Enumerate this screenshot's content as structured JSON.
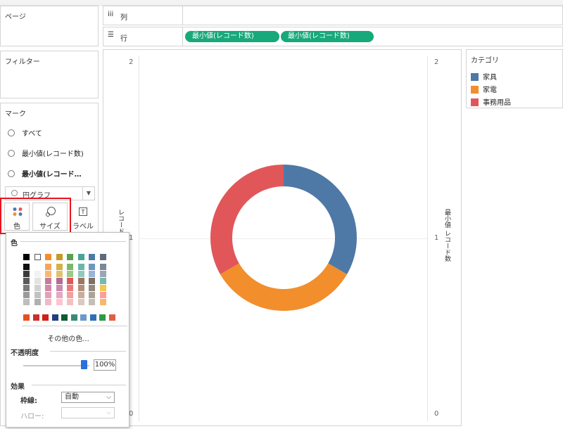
{
  "left_panel": {
    "pages_title": "ページ",
    "filters_title": "フィルター",
    "marks_title": "マーク",
    "marks_items": [
      "すべて",
      "最小値(レコード数)",
      "最小値(レコード…"
    ],
    "mark_type": "円グラフ",
    "buttons": {
      "color": "色",
      "size": "サイズ",
      "label": "ラベル"
    }
  },
  "shelves": {
    "columns_label": "列",
    "rows_label": "行",
    "rows_pills": [
      "最小値(レコード数)",
      "最小値(レコード数)"
    ]
  },
  "legend": {
    "title": "カテゴリ",
    "items": [
      {
        "label": "家具",
        "color": "#4e79a7"
      },
      {
        "label": "家電",
        "color": "#f28e2b"
      },
      {
        "label": "事務用品",
        "color": "#e15759"
      }
    ]
  },
  "chart_data": {
    "type": "pie",
    "donut": true,
    "slices": [
      {
        "label": "家具",
        "value": 1
      },
      {
        "label": "家電",
        "value": 1
      },
      {
        "label": "事務用品",
        "value": 1
      }
    ],
    "left_axis": {
      "ticks": [
        "2",
        "1",
        "0"
      ],
      "label": "レコード数"
    },
    "right_axis": {
      "ticks": [
        "2",
        "1",
        "0"
      ],
      "label": "最小値 レコード数"
    }
  },
  "color_popup": {
    "title": "色",
    "more_colors": "その他の色...",
    "opacity_label": "不透明度",
    "opacity_value": "100%",
    "opacity": 1.0,
    "effects_label": "効果",
    "border_label": "枠線:",
    "border_value": "自動",
    "halo_label": "ハロー:",
    "halo_value": "",
    "palette_top": [
      "#000000",
      "#ffffff",
      "#f28e2b",
      "#c49a28",
      "#59a14f",
      "#49a399",
      "#4e79a7",
      "#5b6b7d"
    ],
    "palette_cols": [
      [
        "#111111",
        "#3a3a3a",
        "#5a5a5a",
        "#7a7a7a",
        "#9a9a9a",
        "#bdbdbd"
      ],
      [
        "#ffffff",
        "#f2f2f2",
        "#e2e2e2",
        "#d2d2d2",
        "#c2c2c2",
        "#b0b0b0"
      ],
      [
        "#f5a55a",
        "#f7b874",
        "#c77b9b",
        "#d18aa9",
        "#e4a0b6",
        "#f0b9c9"
      ],
      [
        "#d4b04a",
        "#dfc270",
        "#b46a96",
        "#c98ab0",
        "#e6a7c0",
        "#ffc2d2"
      ],
      [
        "#7ab86a",
        "#9cc98d",
        "#e15759",
        "#eb7a7b",
        "#f2a0a0",
        "#f7c0c0"
      ],
      [
        "#6db5ab",
        "#93c8bf",
        "#9c755f",
        "#b0907c",
        "#c7ad9b",
        "#dcc9bb"
      ],
      [
        "#6f95c1",
        "#98b4d6",
        "#7c6f63",
        "#94897e",
        "#aca398",
        "#c6beb4"
      ],
      [
        "#7a8898",
        "#9aa6b3",
        "#76b7b2",
        "#f0c84a",
        "#ff9d9a",
        "#f6b86a"
      ]
    ],
    "palette_bottom": [
      "#e8501f",
      "#c9302c",
      "#d0201a",
      "#204080",
      "#0e5a34",
      "#3a8a7a",
      "#6a9ac9",
      "#2f6fb5",
      "#2c9a46",
      "#e06040"
    ]
  }
}
